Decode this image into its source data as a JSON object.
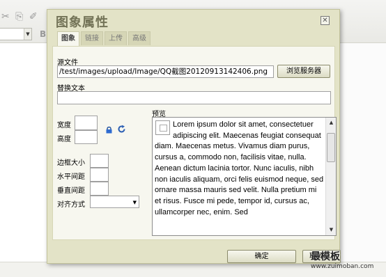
{
  "dialog": {
    "title": "图象属性",
    "close_icon": "close-icon"
  },
  "tabs": [
    {
      "label": "图象",
      "active": true
    },
    {
      "label": "链接",
      "active": false
    },
    {
      "label": "上传",
      "active": false
    },
    {
      "label": "高级",
      "active": false
    }
  ],
  "form": {
    "source_label": "源文件",
    "source_value": "/test/images/upload/Image/QQ截图20120913142406.png",
    "browse_button": "浏览服务器",
    "alt_label": "替换文本",
    "alt_value": "",
    "width_label": "宽度",
    "width_value": "",
    "height_label": "高度",
    "height_value": "",
    "border_label": "边框大小",
    "border_value": "",
    "hspace_label": "水平间距",
    "hspace_value": "",
    "vspace_label": "垂直间距",
    "vspace_value": "",
    "align_label": "对齐方式",
    "align_value": ""
  },
  "preview": {
    "label": "预览",
    "text": "Lorem ipsum dolor sit amet, consectetuer adipiscing elit. Maecenas feugiat consequat diam. Maecenas metus. Vivamus diam purus, cursus a, commodo non, facilisis vitae, nulla. Aenean dictum lacinia tortor. Nunc iaculis, nibh non iaculis aliquam, orci felis euismod neque, sed ornare massa mauris sed velit. Nulla pretium mi et risus. Fusce mi pede, tempor id, cursus ac, ullamcorper nec, enim. Sed"
  },
  "footer": {
    "ok_button": "确定",
    "cancel_button": "取消"
  },
  "watermark": {
    "brand": "最模板",
    "url": "www.zuimoban.com"
  },
  "colors": {
    "dialog_bg": "#e3e3c7",
    "panel_bg": "#f7f7ef",
    "title": "#737357"
  }
}
